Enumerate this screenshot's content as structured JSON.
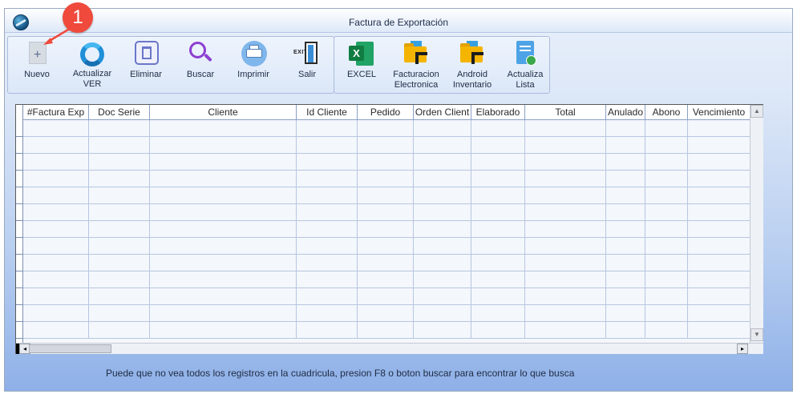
{
  "window": {
    "title": "Factura de Exportación"
  },
  "badge": {
    "text": "1"
  },
  "toolbar": {
    "main_buttons": [
      {
        "label": "Nuevo",
        "icon": "new-document-icon"
      },
      {
        "label": "Actualizar\nVER",
        "icon": "refresh-icon"
      },
      {
        "label": "Eliminar",
        "icon": "trash-icon"
      },
      {
        "label": "Buscar",
        "icon": "search-icon"
      },
      {
        "label": "Imprimir",
        "icon": "printer-icon"
      },
      {
        "label": "Salir",
        "icon": "exit-door-icon"
      }
    ],
    "extra_buttons": [
      {
        "label": "EXCEL",
        "icon": "excel-icon"
      },
      {
        "label": "Facturacion\nElectronica",
        "icon": "folder-arrow-icon"
      },
      {
        "label": "Android\nInventario",
        "icon": "folder-arrow-icon"
      },
      {
        "label": "Actualiza\nLista",
        "icon": "list-update-icon"
      }
    ]
  },
  "grid": {
    "columns": [
      "#Factura Exp",
      "Doc Serie",
      "Cliente",
      "Id Cliente",
      "Pedido",
      "Orden Client",
      "Elaborado",
      "Total",
      "Anulado",
      "Abono",
      "Vencimiento"
    ],
    "rows": []
  },
  "footer": {
    "hint": "Puede que no vea todos los registros en la cuadricula, presion F8 o boton buscar para encontrar lo que busca"
  },
  "colors": {
    "accent": "#1f8fd8",
    "badge": "#ef4a3c",
    "window_gradient_bottom": "#8eb0e8"
  }
}
